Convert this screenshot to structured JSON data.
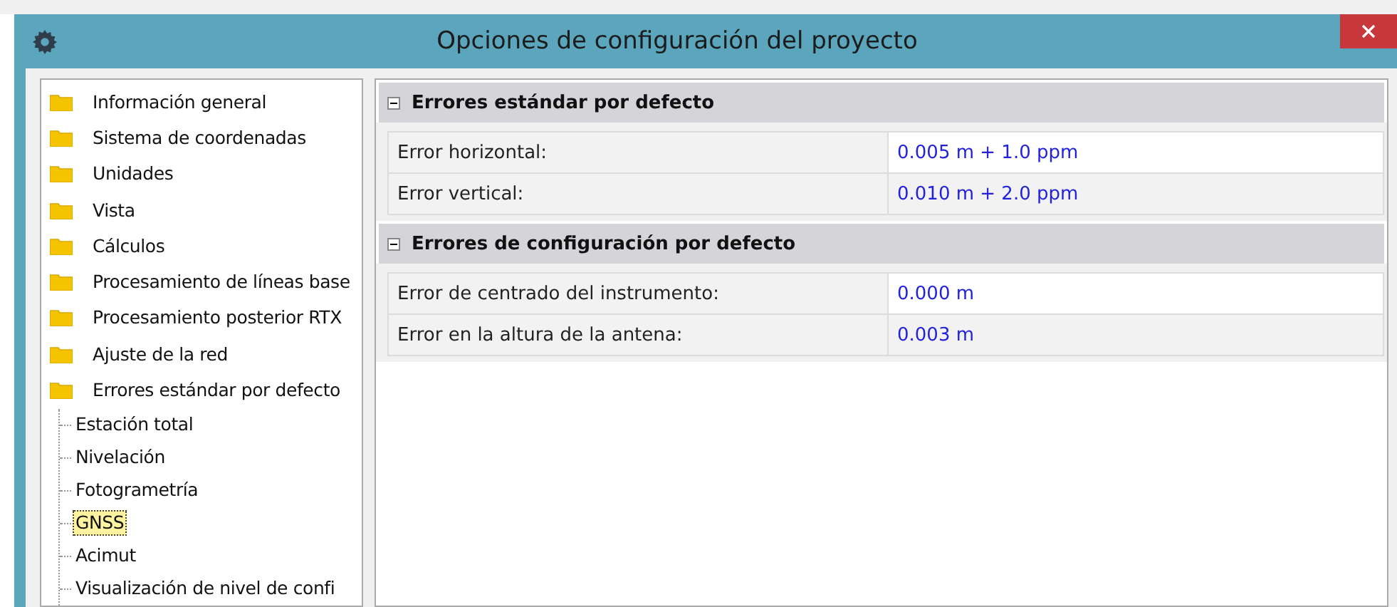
{
  "window": {
    "title": "Opciones de configuración del proyecto"
  },
  "tree": [
    {
      "label": "Información general",
      "selected": false
    },
    {
      "label": "Sistema de coordenadas",
      "selected": false
    },
    {
      "label": "Unidades",
      "selected": false
    },
    {
      "label": "Vista",
      "selected": false
    },
    {
      "label": "Cálculos",
      "selected": false
    },
    {
      "label": "Procesamiento de líneas base",
      "selected": false
    },
    {
      "label": "Procesamiento posterior RTX",
      "selected": false
    },
    {
      "label": "Ajuste de la red",
      "selected": false
    },
    {
      "label": "Errores estándar por defecto",
      "selected": false,
      "children": [
        {
          "label": "Estación total",
          "selected": false
        },
        {
          "label": "Nivelación",
          "selected": false
        },
        {
          "label": "Fotogrametría",
          "selected": false
        },
        {
          "label": "GNSS",
          "selected": true
        },
        {
          "label": "Acimut",
          "selected": false
        },
        {
          "label": "Visualización de nivel de confi",
          "selected": false
        }
      ]
    }
  ],
  "sections": [
    {
      "title": "Errores estándar por defecto",
      "expanded": true,
      "rows": [
        {
          "label": "Error horizontal:",
          "value": "0.005 m + 1.0 ppm"
        },
        {
          "label": "Error vertical:",
          "value": "0.010 m + 2.0 ppm"
        }
      ]
    },
    {
      "title": "Errores de configuración por defecto",
      "expanded": true,
      "rows": [
        {
          "label": "Error de centrado del instrumento:",
          "value": "0.000 m"
        },
        {
          "label": "Error en la altura de la antena:",
          "value": "0.003 m"
        }
      ]
    }
  ]
}
